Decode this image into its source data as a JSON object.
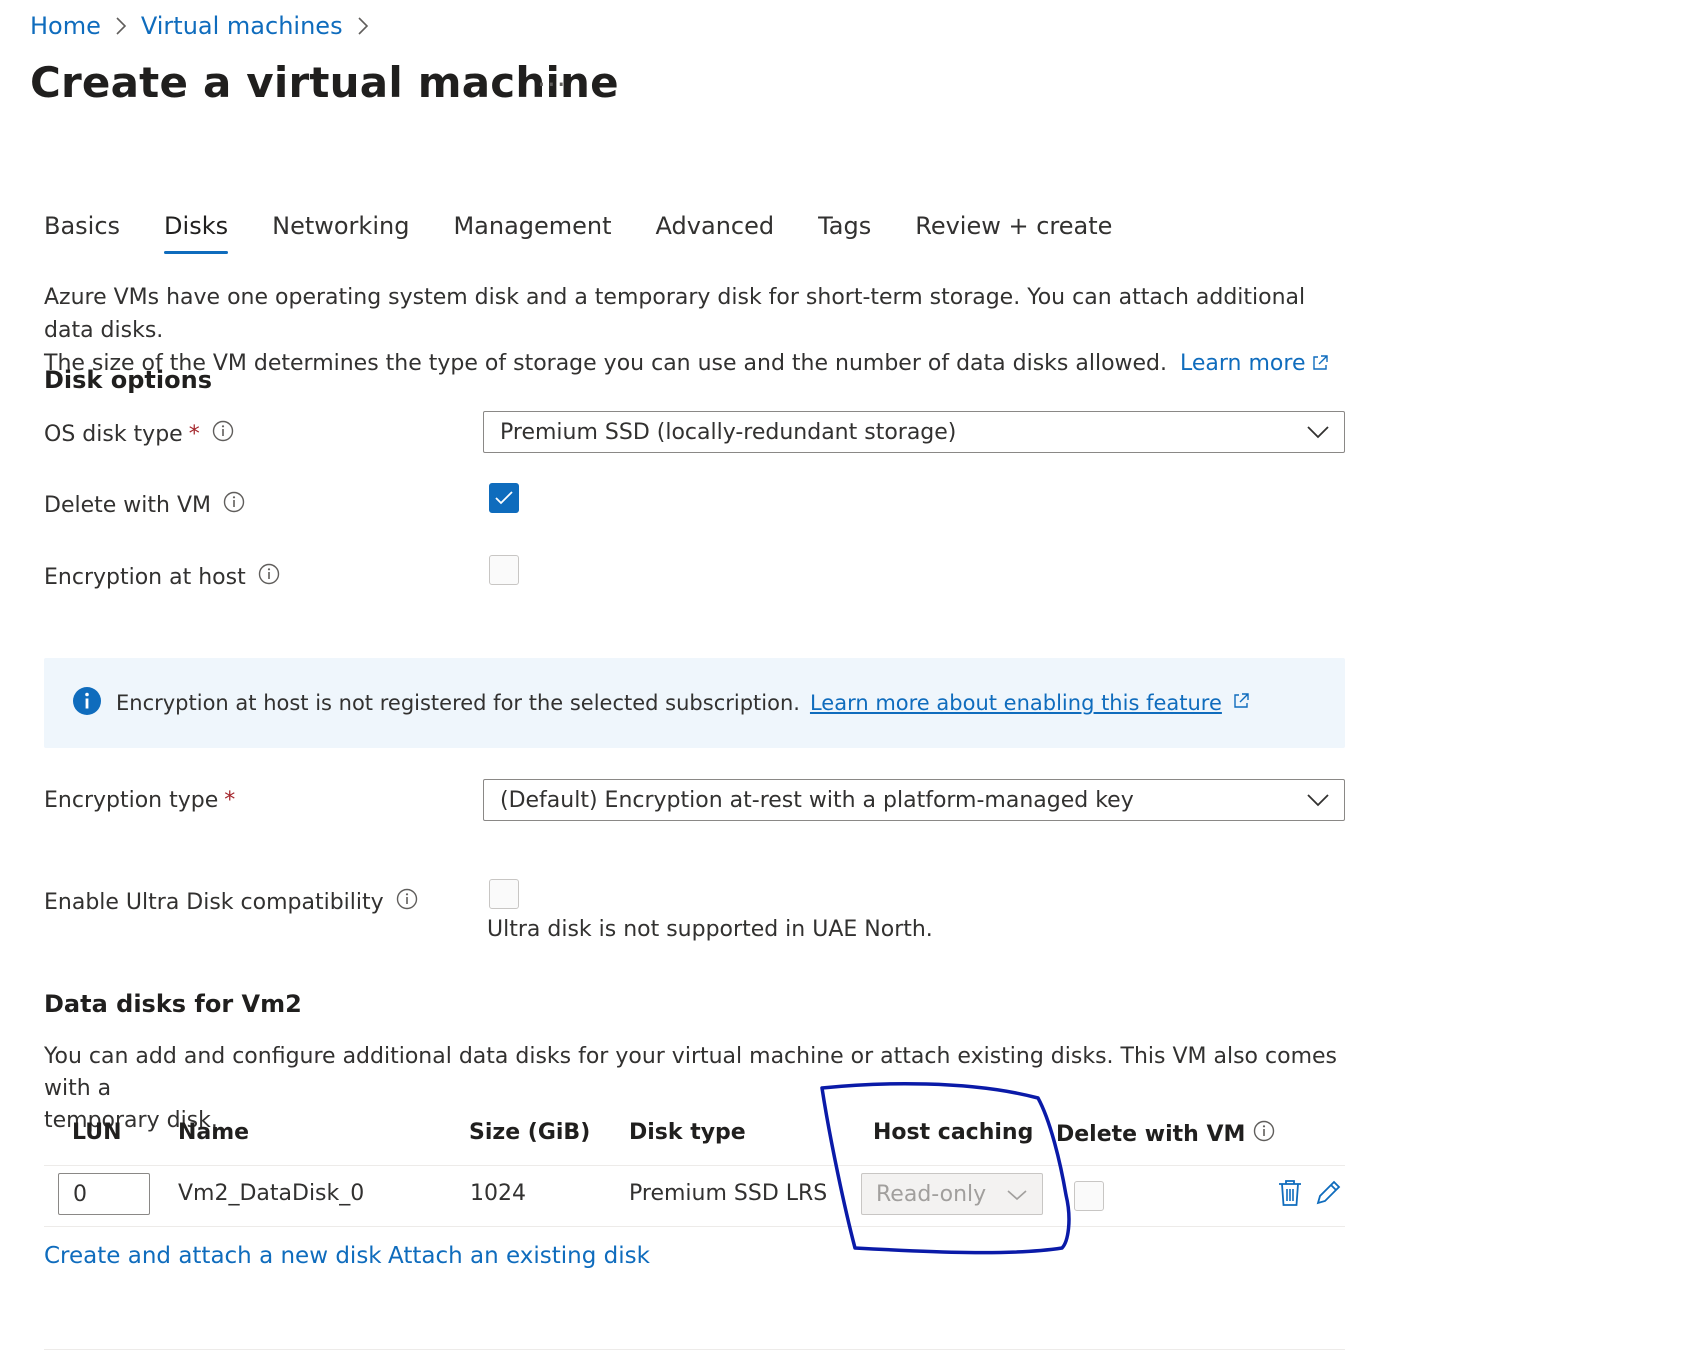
{
  "breadcrumb": {
    "home": "Home",
    "vms": "Virtual machines"
  },
  "page": {
    "title": "Create a virtual machine",
    "more": "···"
  },
  "tabs": [
    {
      "label": "Basics",
      "active": false
    },
    {
      "label": "Disks",
      "active": true
    },
    {
      "label": "Networking",
      "active": false
    },
    {
      "label": "Management",
      "active": false
    },
    {
      "label": "Advanced",
      "active": false
    },
    {
      "label": "Tags",
      "active": false
    },
    {
      "label": "Review + create",
      "active": false
    }
  ],
  "intro": {
    "line1": "Azure VMs have one operating system disk and a temporary disk for short-term storage. You can attach additional data disks.",
    "line2": "The size of the VM determines the type of storage you can use and the number of data disks allowed.",
    "learn_more": "Learn more"
  },
  "disk_options": {
    "heading": "Disk options",
    "os_disk_type_label": "OS disk type",
    "os_disk_type_value": "Premium SSD (locally-redundant storage)",
    "delete_with_vm_label": "Delete with VM",
    "encryption_at_host_label": "Encryption at host",
    "required_marker": "*"
  },
  "banner": {
    "text": "Encryption at host is not registered for the selected subscription.",
    "link": "Learn more about enabling this feature"
  },
  "encryption": {
    "label": "Encryption type",
    "value": "(Default) Encryption at-rest with a platform-managed key"
  },
  "ultra": {
    "label": "Enable Ultra Disk compatibility",
    "note": "Ultra disk is not supported in UAE North."
  },
  "data_disks": {
    "heading": "Data disks for Vm2",
    "desc_line1": "You can add and configure additional data disks for your virtual machine or attach existing disks. This VM also comes with a",
    "desc_line2": "temporary disk.",
    "columns": {
      "lun": "LUN",
      "name": "Name",
      "size": "Size (GiB)",
      "disk_type": "Disk type",
      "host_caching": "Host caching",
      "delete_with_vm": "Delete with VM"
    },
    "rows": [
      {
        "lun": "0",
        "name": "Vm2_DataDisk_0",
        "size": "1024",
        "disk_type": "Premium SSD LRS",
        "host_caching": "Read-only"
      }
    ],
    "create_link": "Create and attach a new disk",
    "attach_link": "Attach an existing disk"
  },
  "colors": {
    "accent": "#0f6cbd",
    "annotation": "#0a1aa8"
  }
}
